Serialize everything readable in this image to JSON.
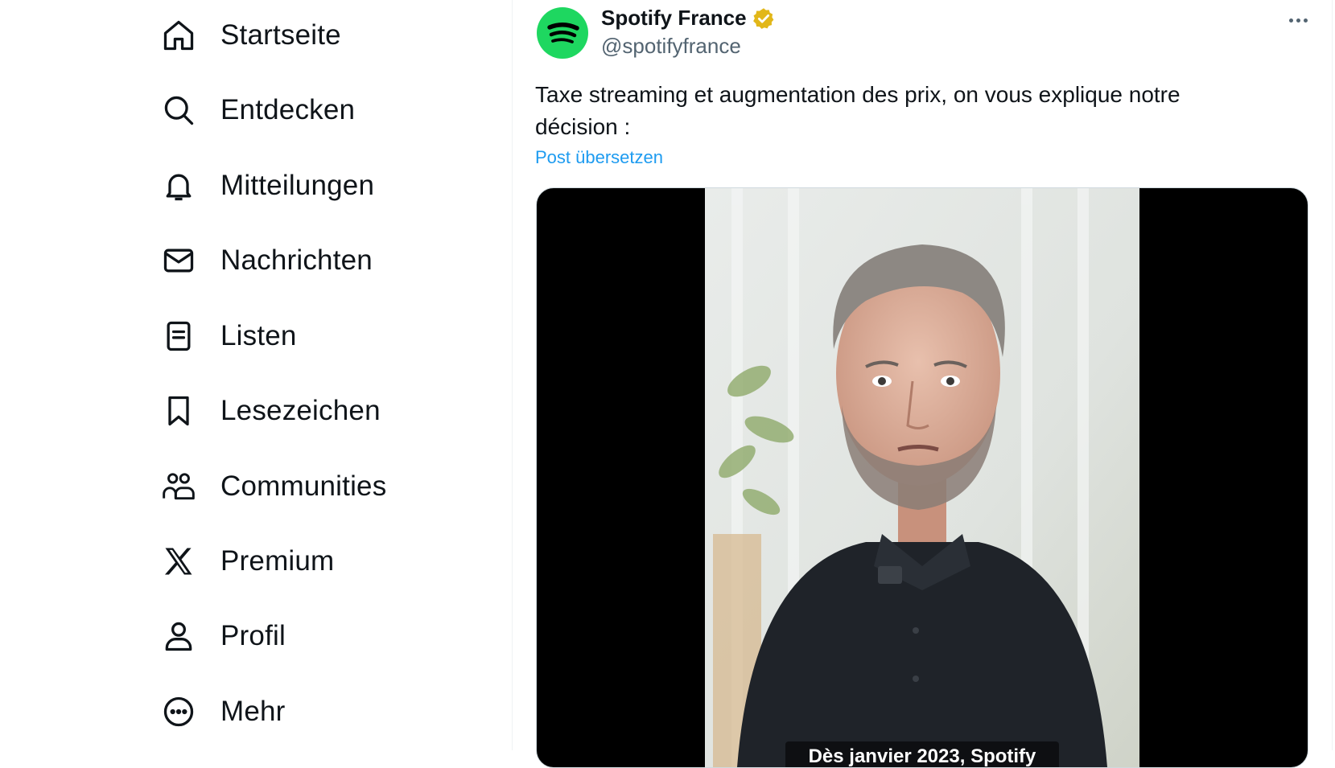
{
  "nav": {
    "items": [
      {
        "label": "Startseite",
        "icon": "home-icon"
      },
      {
        "label": "Entdecken",
        "icon": "search-icon"
      },
      {
        "label": "Mitteilungen",
        "icon": "bell-icon"
      },
      {
        "label": "Nachrichten",
        "icon": "mail-icon"
      },
      {
        "label": "Listen",
        "icon": "list-icon"
      },
      {
        "label": "Lesezeichen",
        "icon": "bookmark-icon"
      },
      {
        "label": "Communities",
        "icon": "communities-icon"
      },
      {
        "label": "Premium",
        "icon": "x-logo-icon"
      },
      {
        "label": "Profil",
        "icon": "profile-icon"
      },
      {
        "label": "Mehr",
        "icon": "more-circle-icon"
      }
    ]
  },
  "tweet": {
    "author_name": "Spotify France",
    "handle": "@spotifyfrance",
    "text": "Taxe streaming et augmentation des prix, on vous explique notre décision :",
    "translate_label": "Post übersetzen",
    "video_caption": "Dès janvier 2023, Spotify"
  },
  "colors": {
    "spotify_green": "#1ed760",
    "link_blue": "#1d9bf0",
    "verified_gold": "#e2b719"
  }
}
